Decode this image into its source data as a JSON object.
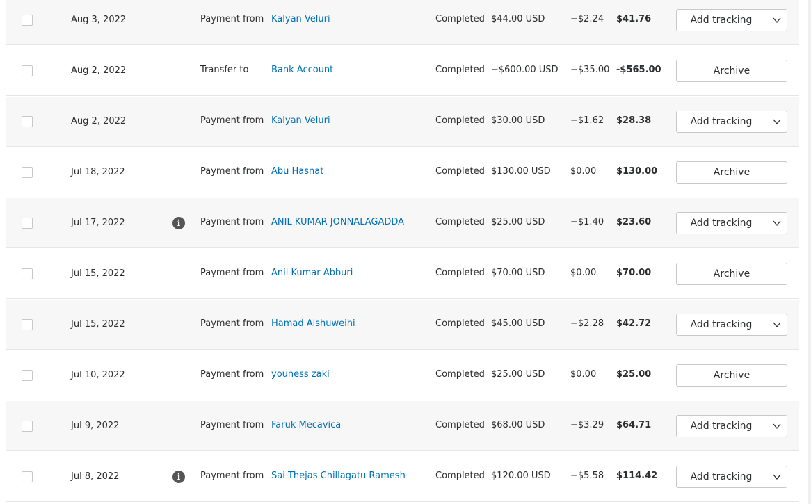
{
  "transactions": [
    {
      "date": "Aug 3, 2022",
      "info": false,
      "type": "Payment from",
      "name": "Kalyan Veluri",
      "status": "Completed",
      "gross": "$44.00 USD",
      "fee": "−$2.24",
      "net": "$41.76",
      "action": "Add tracking",
      "has_menu": true
    },
    {
      "date": "Aug 2, 2022",
      "info": false,
      "type": "Transfer to",
      "name": "Bank Account",
      "status": "Completed",
      "gross": "−$600.00 USD",
      "fee": "−$35.00",
      "net": "-$565.00",
      "action": "Archive",
      "has_menu": false
    },
    {
      "date": "Aug 2, 2022",
      "info": false,
      "type": "Payment from",
      "name": "Kalyan Veluri",
      "status": "Completed",
      "gross": "$30.00 USD",
      "fee": "−$1.62",
      "net": "$28.38",
      "action": "Add tracking",
      "has_menu": true
    },
    {
      "date": "Jul 18, 2022",
      "info": false,
      "type": "Payment from",
      "name": "Abu Hasnat",
      "status": "Completed",
      "gross": "$130.00 USD",
      "fee": "$0.00",
      "net": "$130.00",
      "action": "Archive",
      "has_menu": false
    },
    {
      "date": "Jul 17, 2022",
      "info": true,
      "type": "Payment from",
      "name": "ANIL KUMAR JONNALAGADDA",
      "status": "Completed",
      "gross": "$25.00 USD",
      "fee": "−$1.40",
      "net": "$23.60",
      "action": "Add tracking",
      "has_menu": true
    },
    {
      "date": "Jul 15, 2022",
      "info": false,
      "type": "Payment from",
      "name": "Anil Kumar Abburi",
      "status": "Completed",
      "gross": "$70.00 USD",
      "fee": "$0.00",
      "net": "$70.00",
      "action": "Archive",
      "has_menu": false
    },
    {
      "date": "Jul 15, 2022",
      "info": false,
      "type": "Payment from",
      "name": "Hamad Alshuweihi",
      "status": "Completed",
      "gross": "$45.00 USD",
      "fee": "−$2.28",
      "net": "$42.72",
      "action": "Add tracking",
      "has_menu": true
    },
    {
      "date": "Jul 10, 2022",
      "info": false,
      "type": "Payment from",
      "name": "youness zaki",
      "status": "Completed",
      "gross": "$25.00 USD",
      "fee": "$0.00",
      "net": "$25.00",
      "action": "Archive",
      "has_menu": false
    },
    {
      "date": "Jul 9, 2022",
      "info": false,
      "type": "Payment from",
      "name": "Faruk Mecavica",
      "status": "Completed",
      "gross": "$68.00 USD",
      "fee": "−$3.29",
      "net": "$64.71",
      "action": "Add tracking",
      "has_menu": true
    },
    {
      "date": "Jul 8, 2022",
      "info": true,
      "type": "Payment from",
      "name": "Sai Thejas Chillagatu Ramesh",
      "status": "Completed",
      "gross": "$120.00 USD",
      "fee": "−$5.58",
      "net": "$114.42",
      "action": "Add tracking",
      "has_menu": true
    }
  ],
  "icons": {
    "info": "info-icon",
    "menu": "chevron-down-icon",
    "info_glyph": "i"
  },
  "colors": {
    "link": "#0070ba",
    "row_shaded": "#f7f7f7",
    "border": "#c8c8c8"
  }
}
